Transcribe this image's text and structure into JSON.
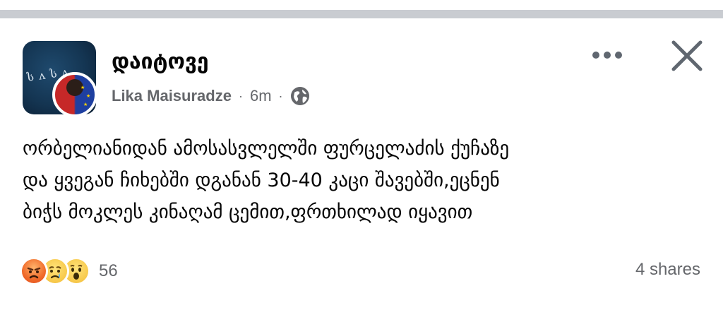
{
  "post": {
    "group_name": "დაიტოვე",
    "author": "Lika Maisuradze",
    "separator": "·",
    "timestamp": "6m",
    "privacy_icon": "globe-icon",
    "lines": [
      "ორბელიანიდან ამოსასვლელში ფურცელაძის ქუჩაზე",
      "და ყვეგან ჩიხებში დგანან 30-40 კაცი შავებში,ეცნენ",
      "ბიჭს მოკლეს კინაღამ ცემით,ფრთხილად იყავით"
    ]
  },
  "header_actions": {
    "more_icon": "more-horizontal-icon",
    "close_icon": "close-icon"
  },
  "footer": {
    "reactions": [
      "angry",
      "sad",
      "wow"
    ],
    "reaction_count": "56",
    "shares": "4 shares"
  },
  "colors": {
    "divider": "#c9ccd1",
    "secondary_text": "#65676b",
    "primary_text": "#050505"
  }
}
